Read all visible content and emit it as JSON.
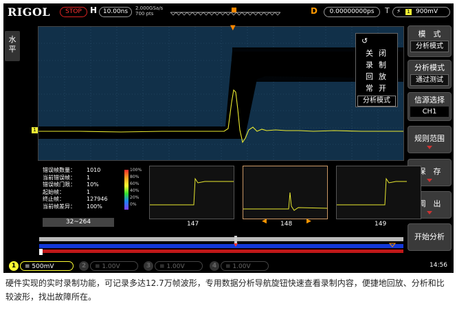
{
  "topbar": {
    "brand": "RIGOL",
    "run_state": "STOP",
    "h_label": "H",
    "timebase": "10.00ns",
    "sample_rate": "2.000GSa/s",
    "memory_depth": "700 pts",
    "d_label": "D",
    "delay": "0.00000000ps",
    "t_label": "T",
    "trigger_level": "900mV"
  },
  "side_tab": {
    "label_line1": "水",
    "label_line2": "平"
  },
  "record_menu": {
    "items": [
      "关闭",
      "录制",
      "回放",
      "常开"
    ],
    "selected": "分析模式"
  },
  "right_menu": {
    "title": "模　式",
    "mode_value": "分析模式",
    "analysis_label": "分析模式",
    "analysis_value": "通过测试",
    "source_label": "信源选择",
    "source_value": "CH1",
    "rule_range": "规则范围",
    "save": "保　存",
    "recall": "调　出",
    "start": "开始分析"
  },
  "stats": [
    {
      "label": "错误帧数量：",
      "value": "1010"
    },
    {
      "label": "当前错误帧：",
      "value": "1"
    },
    {
      "label": "错误帧门限：",
      "value": "10%"
    },
    {
      "label": "起始帧：",
      "value": "1"
    },
    {
      "label": "终止帧：",
      "value": "127946"
    },
    {
      "label": "当前帧差异：",
      "value": "100%"
    }
  ],
  "color_scale": [
    "100%",
    "80%",
    "60%",
    "40%",
    "20%",
    "0%"
  ],
  "frames": {
    "range": "32~264",
    "left": "147",
    "current": "148",
    "right": "149"
  },
  "channels": [
    {
      "num": "1",
      "scale": "500mV",
      "color": "#ffff33",
      "active": true
    },
    {
      "num": "2",
      "scale": "1.00V",
      "color": "#555555",
      "active": false
    },
    {
      "num": "3",
      "scale": "1.00V",
      "color": "#555555",
      "active": false
    },
    {
      "num": "4",
      "scale": "1.00V",
      "color": "#555555",
      "active": false
    }
  ],
  "clock": "14:56",
  "caption": "硬件实现的实时录制功能，可记录多达12.7万帧波形，专用数据分析导航旋钮快速查看录制内容，便捷地回放、分析和比较波形，找出故障所在。",
  "colors": {
    "accent": "#f90",
    "trace": "#ffff33",
    "grid_bg": "#113049",
    "stop": "#ff3333"
  }
}
